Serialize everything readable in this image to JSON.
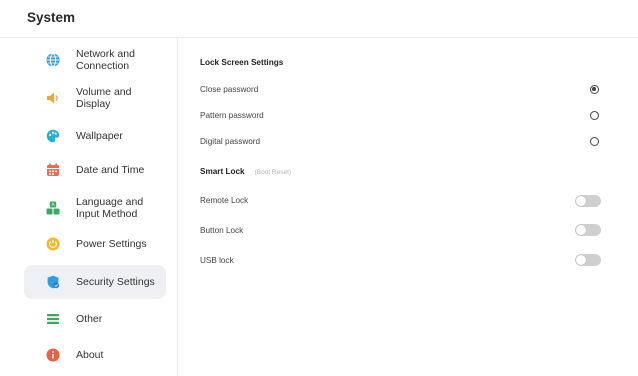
{
  "app": {
    "title": "System"
  },
  "sidebar": {
    "items": [
      {
        "label": "Network and\nConnection",
        "icon": "globe-icon",
        "color": "#2f9be0"
      },
      {
        "label": "Volume and\nDisplay",
        "icon": "speaker-icon",
        "color": "#f2a531"
      },
      {
        "label": "Wallpaper",
        "icon": "palette-icon",
        "color": "#22b0d8"
      },
      {
        "label": "Date and Time",
        "icon": "calendar-icon",
        "color": "#ef6a4d"
      },
      {
        "label": "Language and\nInput Method",
        "icon": "language-icon",
        "color": "#3ea85f"
      },
      {
        "label": "Power Settings",
        "icon": "power-icon",
        "color": "#f5b62a"
      },
      {
        "label": "Security Settings",
        "icon": "shield-icon",
        "color": "#2d9fe0",
        "active": true
      },
      {
        "label": "Other",
        "icon": "list-icon",
        "color": "#3ea85f"
      },
      {
        "label": "About",
        "icon": "info-icon",
        "color": "#ec5e3e"
      }
    ]
  },
  "content": {
    "lock_screen": {
      "title": "Lock Screen Settings",
      "options": [
        {
          "label": "Close password",
          "checked": true
        },
        {
          "label": "Pattern password",
          "checked": false
        },
        {
          "label": "Digital password",
          "checked": false
        }
      ]
    },
    "smart_lock": {
      "title": "Smart Lock",
      "hint": "(Boot Reset)",
      "toggles": [
        {
          "label": "Remote Lock",
          "on": false
        },
        {
          "label": "Button Lock",
          "on": false
        },
        {
          "label": "USB lock",
          "on": false
        }
      ]
    }
  }
}
